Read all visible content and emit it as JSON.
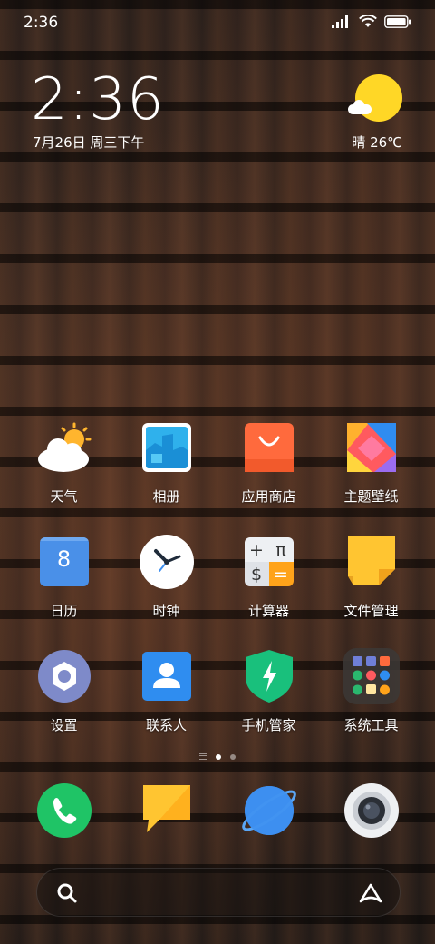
{
  "status_bar": {
    "time": "2:36"
  },
  "lock_widget": {
    "clock": "2:36",
    "date": "7月26日 周三下午",
    "weather": "晴 26℃"
  },
  "apps": [
    {
      "label": "天气",
      "icon": "weather-icon"
    },
    {
      "label": "相册",
      "icon": "gallery-icon"
    },
    {
      "label": "应用商店",
      "icon": "app-store-icon"
    },
    {
      "label": "主题壁纸",
      "icon": "themes-icon"
    },
    {
      "label": "日历",
      "icon": "calendar-icon",
      "badge": "8"
    },
    {
      "label": "时钟",
      "icon": "clock-icon"
    },
    {
      "label": "计算器",
      "icon": "calculator-icon",
      "symbols": [
        "+",
        "π",
        "$",
        "="
      ]
    },
    {
      "label": "文件管理",
      "icon": "file-manager-icon"
    },
    {
      "label": "设置",
      "icon": "settings-icon"
    },
    {
      "label": "联系人",
      "icon": "contacts-icon"
    },
    {
      "label": "手机管家",
      "icon": "security-icon"
    },
    {
      "label": "系统工具",
      "icon": "system-tools-folder-icon"
    }
  ],
  "dock": [
    {
      "icon": "phone-icon"
    },
    {
      "icon": "messages-icon"
    },
    {
      "icon": "browser-icon"
    },
    {
      "icon": "camera-icon"
    }
  ],
  "page_indicator": {
    "pages": 2,
    "current": 1
  },
  "colors": {
    "sun": "#ffd726",
    "phone_green": "#1fc466",
    "note_yellow": "#ffc531",
    "browser_blue": "#3d8ff0",
    "security_green": "#19c07c"
  }
}
